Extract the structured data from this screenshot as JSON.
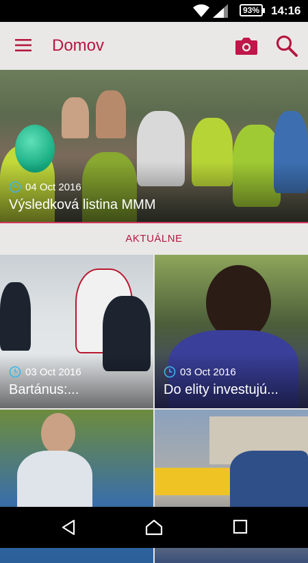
{
  "status_bar": {
    "battery": "93%",
    "time": "14:16",
    "icons": [
      "wifi-icon",
      "signal-icon",
      "battery-icon"
    ]
  },
  "app_bar": {
    "title": "Domov",
    "icons": [
      "menu-icon",
      "camera-icon",
      "search-icon"
    ],
    "accent_color": "#b5163f"
  },
  "featured": {
    "date": "04 Oct 2016",
    "headline": "Výsledková listina MMM"
  },
  "section": {
    "label": "AKTUÁLNE"
  },
  "articles": [
    {
      "date": "03 Oct 2016",
      "headline": "Bartánus:..."
    },
    {
      "date": "03 Oct 2016",
      "headline": "Do elity investujú..."
    },
    {
      "date": "",
      "headline": ""
    },
    {
      "date": "",
      "headline": ""
    }
  ],
  "nav_bar": {
    "icons": [
      "back-icon",
      "home-icon",
      "recents-icon"
    ]
  }
}
